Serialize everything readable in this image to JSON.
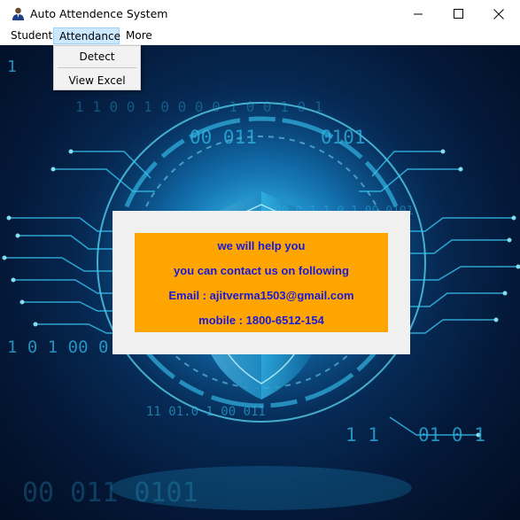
{
  "window": {
    "title": "Auto Attendence System",
    "icon": "user-avatar-icon"
  },
  "menubar": {
    "items": [
      {
        "label": "Student"
      },
      {
        "label": "Attendance"
      },
      {
        "label": "More"
      }
    ]
  },
  "attendance_menu": {
    "items": [
      {
        "label": "Detect"
      },
      {
        "label": "View Excel"
      }
    ]
  },
  "background_text": {
    "row1": "1",
    "row2": "1 1    0 0 1  0 0 0     0 1 0    0 1 0 1",
    "row3": "00 011",
    "row4": "0101",
    "row5": "1 0 1  00 0",
    "row6": "11  01.0 1  00 011",
    "row7": "1 1",
    "row8": "01 0 1",
    "row9": "00 011      0101",
    "row10": "00 0 1 1 0 1  00 0101"
  },
  "info_panel": {
    "line1": "we will help you",
    "line2": "you can contact us on following",
    "line3": "Email  :  ajitverma1503@gmail.com",
    "line4": "mobile : 1800-6512-154"
  },
  "colors": {
    "info_bg": "#ffa500",
    "info_text": "#1a1ad8",
    "dialog_bg": "#f0f0f0",
    "menu_active_bg": "#cce8ff"
  }
}
